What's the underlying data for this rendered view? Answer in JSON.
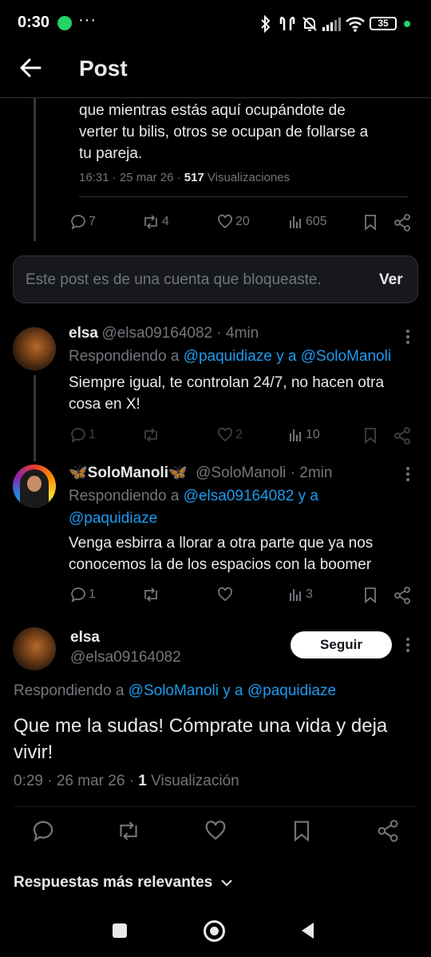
{
  "status_bar": {
    "time": "0:30",
    "dots": "···",
    "battery": "35"
  },
  "header": {
    "title": "Post"
  },
  "main_tweet": {
    "text_lines": [
      "que mientras estás aquí ocupándote de",
      "verter tu bilis, otros se ocupan de follarse a",
      "tu pareja."
    ],
    "meta_prefix": "16:31 · 25 mar 26 · ",
    "views_count": "517",
    "views_label": " Visualizaciones",
    "actions": {
      "replies": "7",
      "reposts": "4",
      "likes": "20",
      "views": "605"
    }
  },
  "blocked_notice": {
    "text": "Este post es de una cuenta que bloqueaste.",
    "button": "Ver"
  },
  "reply1": {
    "name": "elsa",
    "handle": "@elsa09164082 · 4min",
    "replying_prefix": "Respondiendo a ",
    "replying_to": "@paquidiaze y a @SoloManoli",
    "text_lines": [
      "Siempre igual, te controlan 24/7, no hacen otra",
      "cosa en X!"
    ],
    "actions": {
      "replies": "1",
      "reposts": "",
      "likes": "2",
      "views": "10"
    }
  },
  "reply2": {
    "name": "🦋SoloManoli🦋",
    "handle": "@SoloManoli · 2min",
    "replying_prefix": "Respondiendo a ",
    "replying_to_line1": "@elsa09164082 y a",
    "replying_to_line2": "@paquidiaze",
    "text_lines": [
      "Venga esbirra a llorar a otra parte que ya nos",
      "conocemos la de los espacios con la boomer"
    ],
    "actions": {
      "replies": "1",
      "reposts": "",
      "likes": "",
      "views": "3"
    }
  },
  "focus_tweet": {
    "name": "elsa",
    "handle": "@elsa09164082",
    "follow_label": "Seguir",
    "replying_prefix": "Respondiendo a ",
    "replying_to": "@SoloManoli y a @paquidiaze",
    "text_lines": [
      "Que me la sudas! Cómprate una vida y deja",
      "vivir!"
    ],
    "meta_prefix": "0:29 · 26 mar 26 · ",
    "views_count": "1",
    "views_label": " Visualización"
  },
  "sort": {
    "label": "Respuestas más relevantes"
  },
  "colors": {
    "background": "#000000",
    "accent": "#1d9bf0",
    "muted": "#71767b",
    "text": "#e7e9ea"
  }
}
